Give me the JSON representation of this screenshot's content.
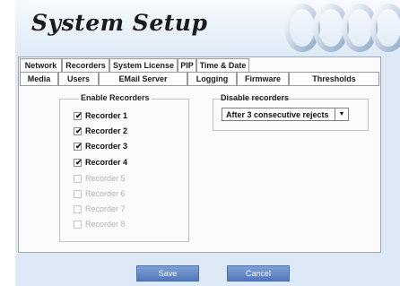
{
  "header": {
    "title": "System Setup"
  },
  "tabs_row1": [
    {
      "label": "Network"
    },
    {
      "label": "Recorders",
      "active": true
    },
    {
      "label": "System License"
    },
    {
      "label": "PIP"
    },
    {
      "label": "Time & Date"
    }
  ],
  "tabs_row2": [
    {
      "label": "Media"
    },
    {
      "label": "Users"
    },
    {
      "label": "EMail Server"
    },
    {
      "label": "Logging"
    },
    {
      "label": "Firmware"
    },
    {
      "label": "Thresholds"
    }
  ],
  "enable_recorders": {
    "title": "Enable Recorders",
    "items": [
      {
        "label": "Recorder 1",
        "checked": true,
        "enabled": true
      },
      {
        "label": "Recorder 2",
        "checked": true,
        "enabled": true
      },
      {
        "label": "Recorder 3",
        "checked": true,
        "enabled": true
      },
      {
        "label": "Recorder 4",
        "checked": true,
        "enabled": true
      },
      {
        "label": "Recorder 5",
        "checked": false,
        "enabled": false
      },
      {
        "label": "Recorder 6",
        "checked": false,
        "enabled": false
      },
      {
        "label": "Recorder 7",
        "checked": false,
        "enabled": false
      },
      {
        "label": "Recorder 8",
        "checked": false,
        "enabled": false
      }
    ]
  },
  "disable_recorders": {
    "title": "Disable recorders",
    "selected": "After 3 consecutive rejects"
  },
  "buttons": {
    "save": "Save",
    "cancel": "Cancel"
  },
  "colors": {
    "background": "#dde9f7",
    "button": "#6287c8"
  }
}
